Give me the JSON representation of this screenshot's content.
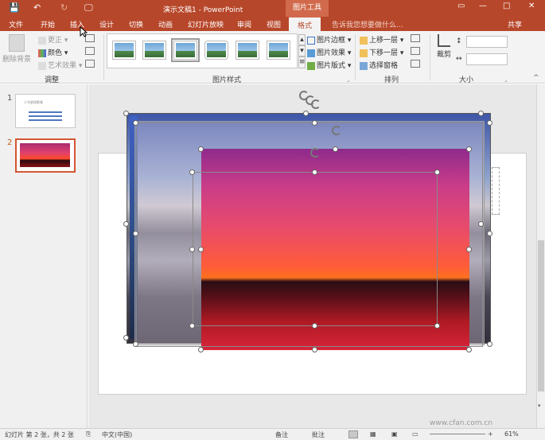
{
  "window": {
    "title": "演示文稿1 - PowerPoint",
    "context_tab": "图片工具",
    "min": "—",
    "max": "□",
    "close": "✕",
    "restore": "▭"
  },
  "quick_access": {
    "save": "💾",
    "undo": "↶",
    "redo": "↻",
    "present": "🖵"
  },
  "tabs": [
    {
      "label": "文件"
    },
    {
      "label": "开始"
    },
    {
      "label": "插入"
    },
    {
      "label": "设计"
    },
    {
      "label": "切换"
    },
    {
      "label": "动画"
    },
    {
      "label": "幻灯片放映"
    },
    {
      "label": "审阅"
    },
    {
      "label": "视图"
    },
    {
      "label": "格式"
    }
  ],
  "tell_me": "告诉我您想要做什么...",
  "share": "共享",
  "ribbon": {
    "remove_bg": "删除背景",
    "corrections": "更正",
    "color": "颜色",
    "artistic": "艺术效果",
    "adjust_label": "调整",
    "styles_label": "图片样式",
    "border": "图片边框",
    "effects": "图片效果",
    "layout": "图片版式",
    "bring_forward": "上移一层",
    "send_backward": "下移一层",
    "selection_pane": "选择窗格",
    "arrange_label": "排列",
    "crop": "裁剪",
    "size_label": "大小"
  },
  "slides": [
    {
      "number": "1",
      "title": "二节屏保影像"
    },
    {
      "number": "2"
    }
  ],
  "status": {
    "slide_info": "幻灯片 第 2 张，共 2 张",
    "language": "中文(中国)",
    "notes": "备注",
    "comments": "批注",
    "zoom": "61%",
    "watermark": "www.cfan.com.cn"
  },
  "colors": {
    "accent": "#b7472a",
    "context": "#d16a4c"
  }
}
